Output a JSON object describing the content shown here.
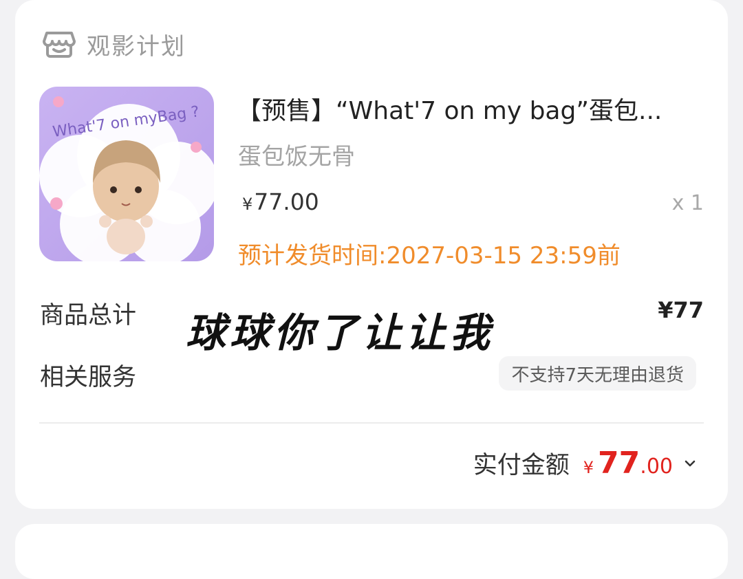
{
  "shop": {
    "name": "观影计划",
    "icon": "store-icon"
  },
  "product": {
    "title": "【预售】“What'7 on my bag”蛋包...",
    "spec": "蛋包饭无骨",
    "price_symbol": "¥",
    "price": "77.00",
    "quantity": "x 1",
    "ship_time": "预计发货时间:2027-03-15 23:59前",
    "image_text": "What'7 on myBag ?"
  },
  "summary": {
    "total_label": "商品总计",
    "total_value": "¥77",
    "service_label": "相关服务",
    "service_tag": "不支持7天无理由退货"
  },
  "paid": {
    "label": "实付金额",
    "symbol": "¥",
    "integer": "77",
    "decimal": ".00"
  },
  "overlay": {
    "handwriting": "球球你了让让我"
  },
  "colors": {
    "accent_red": "#e1231e",
    "ship_orange": "#f08c2b",
    "muted": "#a4a4a4"
  }
}
